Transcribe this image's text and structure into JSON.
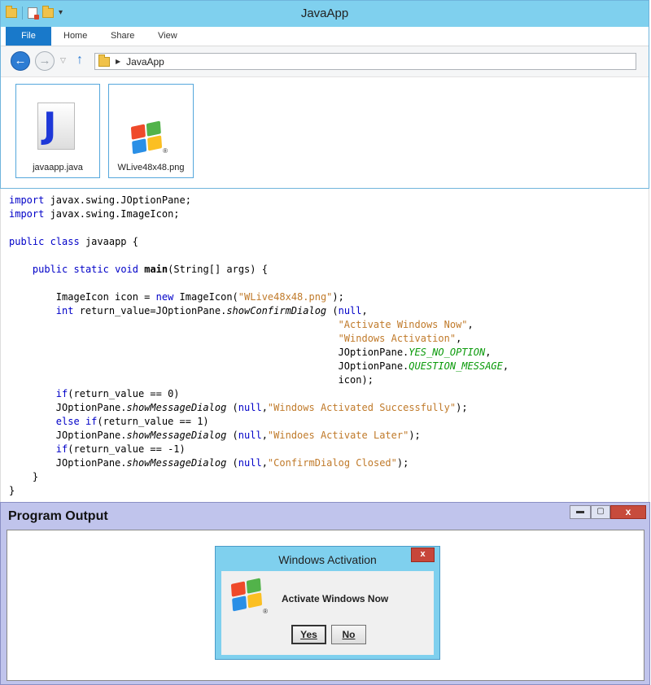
{
  "explorer": {
    "title": "JavaApp",
    "tabs": [
      {
        "label": "File"
      },
      {
        "label": "Home"
      },
      {
        "label": "Share"
      },
      {
        "label": "View"
      }
    ],
    "address": "JavaApp",
    "files": [
      {
        "name": "javaapp.java",
        "icon": "java-file-icon"
      },
      {
        "name": "WLive48x48.png",
        "icon": "windows-logo-icon"
      }
    ],
    "accent_color": "#7fd0ee"
  },
  "code": {
    "lines": [
      "import javax.swing.JOptionPane;",
      "import javax.swing.ImageIcon;",
      "",
      "public class javaapp {",
      "",
      "    public static void main(String[] args) {",
      "",
      "        ImageIcon icon = new ImageIcon(\"WLive48x48.png\");",
      "        int return_value=JOptionPane.showConfirmDialog (null,",
      "                                                        \"Activate Windows Now\",",
      "                                                        \"Windows Activation\",",
      "                                                        JOptionPane.YES_NO_OPTION,",
      "                                                        JOptionPane.QUESTION_MESSAGE,",
      "                                                        icon);",
      "        if(return_value == 0)",
      "        JOptionPane.showMessageDialog (null,\"Windows Activated Successfully\");",
      "        else if(return_value == 1)",
      "        JOptionPane.showMessageDialog (null,\"Windoes Activate Later\");",
      "        if(return_value == -1)",
      "        JOptionPane.showMessageDialog (null,\"ConfirmDialog Closed\");",
      "    }",
      "}"
    ]
  },
  "output": {
    "title": "Program Output",
    "min_label": "▬",
    "max_label": "▢",
    "close_label": "x",
    "dialog": {
      "title": "Windows Activation",
      "close_label": "x",
      "message": "Activate Windows Now",
      "yes_label": "Yes",
      "no_label": "No"
    },
    "panel_color": "#c0c4ec"
  }
}
